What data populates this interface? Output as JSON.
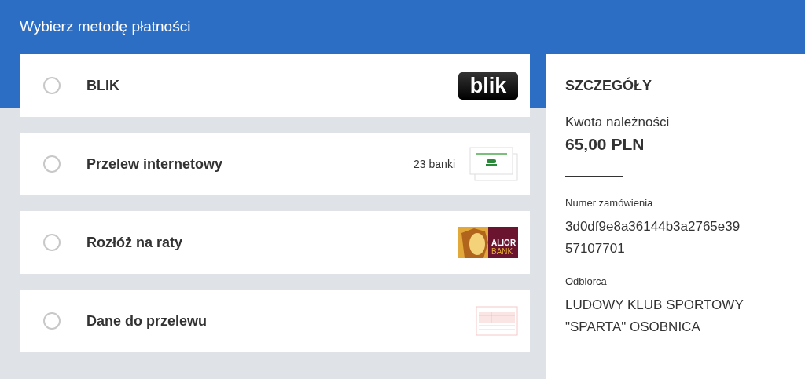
{
  "header": {
    "title": "Wybierz metodę płatności"
  },
  "methods": [
    {
      "label": "BLIK",
      "selected": false,
      "kind": "blik",
      "logo_text": "blik"
    },
    {
      "label": "Przelew internetowy",
      "selected": false,
      "kind": "banks",
      "count": "23 banki"
    },
    {
      "label": "Rozłóż na raty",
      "selected": false,
      "kind": "alior",
      "logo_lines": [
        "ALIOR",
        "BANK"
      ]
    },
    {
      "label": "Dane do przelewu",
      "selected": false,
      "kind": "transfer"
    }
  ],
  "details": {
    "title": "SZCZEGÓŁY",
    "amount_label": "Kwota należności",
    "amount": "65,00 PLN",
    "order_label": "Numer zamówienia",
    "order_number": "3d0df9e8a36144b3a2765e39 57107701",
    "recipient_label": "Odbiorca",
    "recipient": "LUDOWY KLUB SPORTOWY \"SPARTA\" OSOBNICA"
  }
}
